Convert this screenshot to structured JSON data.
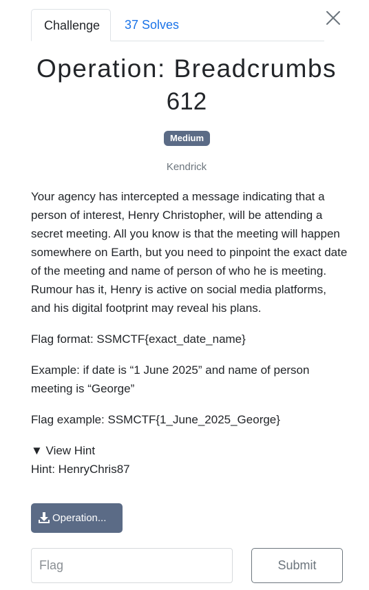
{
  "tabs": {
    "challenge": "Challenge",
    "solves": "37 Solves"
  },
  "challenge": {
    "title": "Operation: Breadcrumbs",
    "points": "612",
    "difficulty": "Medium",
    "author": "Kendrick"
  },
  "description": {
    "p1": "Your agency has intercepted a message indicating that a person of interest, Henry Christopher, will be attending a secret meeting. All you know is that the meeting will happen somewhere on Earth, but you need to pinpoint the exact date of the meeting and name of person of who he is meeting. Rumour has it, Henry is active on social media platforms, and his digital footprint may reveal his plans.",
    "p2": "Flag format: SSMCTF{exact_date_name}",
    "p3": "Example: if date is “1 June 2025” and name of person meeting is “George”",
    "p4": "Flag example: SSMCTF{1_June_2025_George}"
  },
  "hint": {
    "toggle": "▼ View Hint",
    "text": "Hint: HenryChris87"
  },
  "file": {
    "label": "Operation..."
  },
  "flag": {
    "placeholder": "Flag",
    "value": ""
  },
  "submit": {
    "label": "Submit"
  },
  "colors": {
    "badge": "#5b6b86",
    "link": "#1a73e8",
    "file_button": "#5b6b86"
  },
  "icons": {
    "close": "close-icon",
    "download": "download-icon"
  }
}
